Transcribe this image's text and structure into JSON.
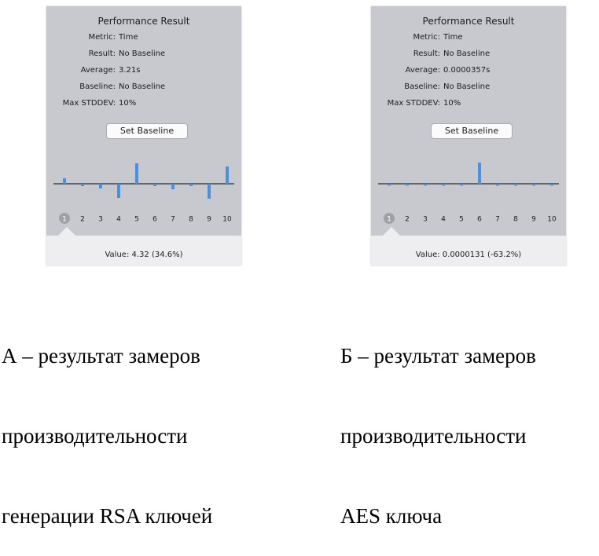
{
  "panels": [
    {
      "title": "Performance Result",
      "rows": [
        {
          "label": "Metric:",
          "value": "Time"
        },
        {
          "label": "Result:",
          "value": "No Baseline"
        },
        {
          "label": "Average:",
          "value": "3.21s"
        },
        {
          "label": "Baseline:",
          "value": "No Baseline"
        },
        {
          "label": "Max STDDEV:",
          "value": "10%"
        }
      ],
      "button_label": "Set Baseline",
      "value_line": "Value:  4.32 (34.6%)",
      "selected_index": 1,
      "chart_data": {
        "type": "bar",
        "categories": [
          "1",
          "2",
          "3",
          "4",
          "5",
          "6",
          "7",
          "8",
          "9",
          "10"
        ],
        "values": [
          0.35,
          -0.15,
          -0.3,
          -0.9,
          1.3,
          -0.15,
          -0.35,
          -0.15,
          -0.95,
          1.1
        ],
        "color": "#4a90e2"
      }
    },
    {
      "title": "Performance Result",
      "rows": [
        {
          "label": "Metric:",
          "value": "Time"
        },
        {
          "label": "Result:",
          "value": "No Baseline"
        },
        {
          "label": "Average:",
          "value": "0.0000357s"
        },
        {
          "label": "Baseline:",
          "value": "No Baseline"
        },
        {
          "label": "Max STDDEV:",
          "value": "10%"
        }
      ],
      "button_label": "Set Baseline",
      "value_line": "Value:  0.0000131 (-63.2%)",
      "selected_index": 1,
      "chart_data": {
        "type": "bar",
        "categories": [
          "1",
          "2",
          "3",
          "4",
          "5",
          "6",
          "7",
          "8",
          "9",
          "10"
        ],
        "values": [
          -0.12,
          -0.12,
          -0.12,
          -0.12,
          -0.12,
          1.35,
          -0.12,
          -0.12,
          -0.12,
          -0.12
        ],
        "color": "#4a90e2"
      }
    }
  ],
  "captions": [
    {
      "lines": [
        "А – результат замеров",
        "производительности",
        "генерации RSA ключей"
      ]
    },
    {
      "lines": [
        "Б – результат замеров",
        "производительности",
        "AES ключа"
      ]
    }
  ]
}
